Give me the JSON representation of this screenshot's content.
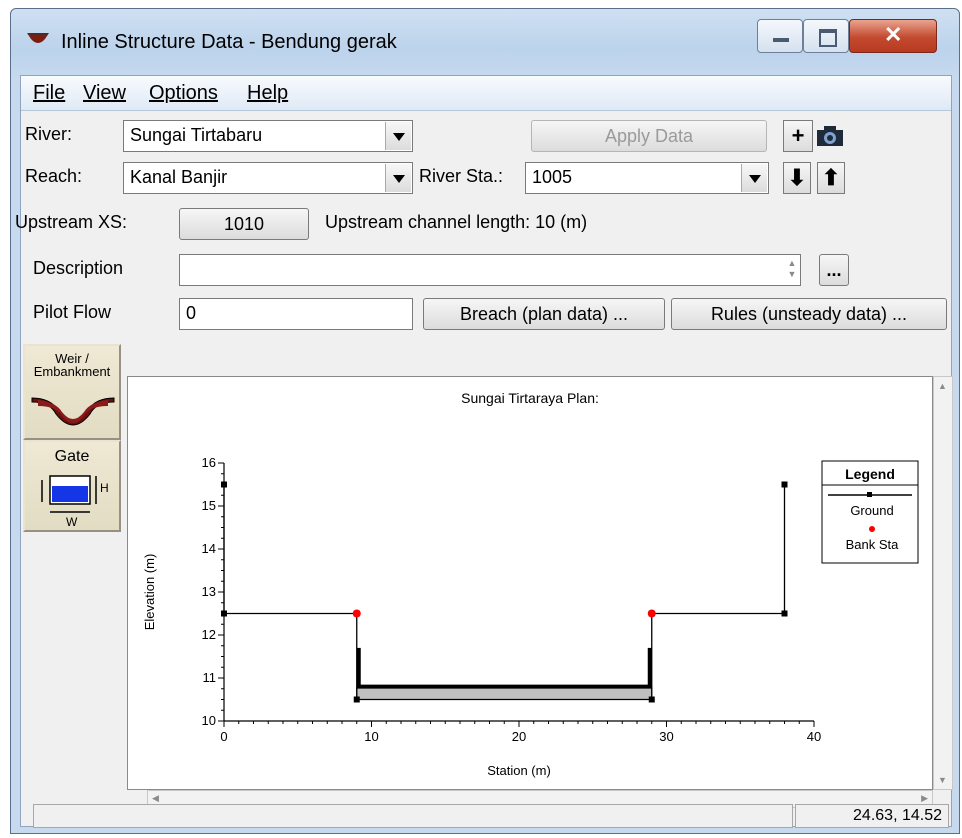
{
  "window": {
    "title": "Inline Structure Data - Bendung gerak"
  },
  "menu": [
    "File",
    "View",
    "Options",
    "Help"
  ],
  "form": {
    "river_label": "River:",
    "river_value": "Sungai Tirtabaru",
    "apply_label": "Apply Data",
    "reach_label": "Reach:",
    "reach_value": "Kanal Banjir",
    "river_sta_label": "River Sta.:",
    "river_sta_value": "1005",
    "upstream_xs_label": "Upstream XS:",
    "upstream_xs_value": "1010",
    "upstream_len_text": "Upstream channel length: 10 (m)",
    "description_label": "Description",
    "description_value": "",
    "pilot_flow_label": "Pilot Flow",
    "pilot_flow_value": "0",
    "breach_label": "Breach (plan data) ...",
    "rules_label": "Rules (unsteady data) ...",
    "ellipsis_label": "..."
  },
  "tools": {
    "weir_label": "Weir / Embankment",
    "gate_label": "Gate",
    "gate_h": "H",
    "gate_w": "W"
  },
  "chart_data": {
    "type": "line",
    "title": "Sungai Tirtaraya      Plan:",
    "xlabel": "Station (m)",
    "ylabel": "Elevation (m)",
    "xlim": [
      0,
      40
    ],
    "ylim": [
      10,
      16
    ],
    "xticks": [
      0,
      10,
      20,
      30,
      40
    ],
    "yticks": [
      10,
      11,
      12,
      13,
      14,
      15,
      16
    ],
    "series": [
      {
        "name": "Ground",
        "color": "#000000",
        "x": [
          0,
          0,
          9,
          9,
          29,
          29,
          38,
          38
        ],
        "y": [
          15.5,
          12.5,
          12.5,
          10.5,
          10.5,
          12.5,
          12.5,
          15.5
        ]
      },
      {
        "name": "Bank Sta",
        "color": "#ff0000",
        "x": [
          9,
          29
        ],
        "y": [
          12.5,
          12.5
        ]
      }
    ],
    "structure": {
      "deck_top": 10.8,
      "deck_bottom": 10.65,
      "left_x": 9,
      "right_x": 29,
      "fill": "#c0c0c0"
    },
    "legend_title": "Legend",
    "legend": [
      "Ground",
      "Bank Sta"
    ],
    "legend_position": "right"
  },
  "status": {
    "coords": "24.63, 14.52"
  }
}
